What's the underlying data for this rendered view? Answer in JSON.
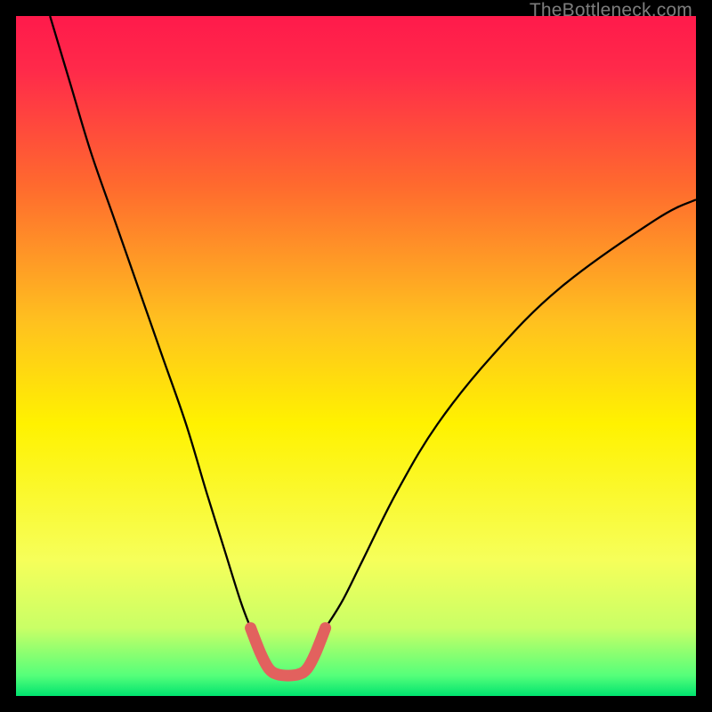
{
  "watermark": "TheBottleneck.com",
  "chart_data": {
    "type": "line",
    "title": "",
    "xlabel": "",
    "ylabel": "",
    "xlim": [
      0,
      100
    ],
    "ylim": [
      0,
      100
    ],
    "gradient_stops": [
      {
        "offset": 0,
        "color": "#ff1a4b"
      },
      {
        "offset": 0.08,
        "color": "#ff2a4a"
      },
      {
        "offset": 0.25,
        "color": "#ff6a2e"
      },
      {
        "offset": 0.45,
        "color": "#ffc11f"
      },
      {
        "offset": 0.6,
        "color": "#fff200"
      },
      {
        "offset": 0.8,
        "color": "#f6ff5a"
      },
      {
        "offset": 0.9,
        "color": "#c9ff66"
      },
      {
        "offset": 0.97,
        "color": "#55ff7a"
      },
      {
        "offset": 1.0,
        "color": "#00e36f"
      }
    ],
    "series": [
      {
        "name": "left-curve",
        "stroke": "#000000",
        "stroke_width": 2.3,
        "points_xy": [
          [
            5.0,
            100.0
          ],
          [
            8.0,
            90.0
          ],
          [
            11.0,
            80.0
          ],
          [
            14.5,
            70.0
          ],
          [
            18.0,
            60.0
          ],
          [
            21.5,
            50.0
          ],
          [
            25.0,
            40.0
          ],
          [
            28.0,
            30.0
          ],
          [
            30.5,
            22.0
          ],
          [
            33.0,
            14.0
          ],
          [
            34.5,
            10.0
          ]
        ]
      },
      {
        "name": "right-curve",
        "stroke": "#000000",
        "stroke_width": 2.3,
        "points_xy": [
          [
            45.5,
            10.0
          ],
          [
            48.0,
            14.0
          ],
          [
            51.0,
            20.0
          ],
          [
            56.0,
            30.0
          ],
          [
            62.0,
            40.0
          ],
          [
            70.0,
            50.0
          ],
          [
            80.0,
            60.0
          ],
          [
            94.0,
            70.0
          ],
          [
            100.0,
            73.0
          ]
        ]
      },
      {
        "name": "well-bottom",
        "stroke": "#e2615e",
        "stroke_width": 13,
        "linecap": "round",
        "points_xy": [
          [
            34.5,
            10.0
          ],
          [
            36.0,
            6.2
          ],
          [
            37.2,
            4.0
          ],
          [
            38.4,
            3.2
          ],
          [
            40.0,
            3.0
          ],
          [
            41.6,
            3.2
          ],
          [
            42.8,
            4.0
          ],
          [
            44.0,
            6.2
          ],
          [
            45.5,
            10.0
          ]
        ]
      }
    ]
  }
}
